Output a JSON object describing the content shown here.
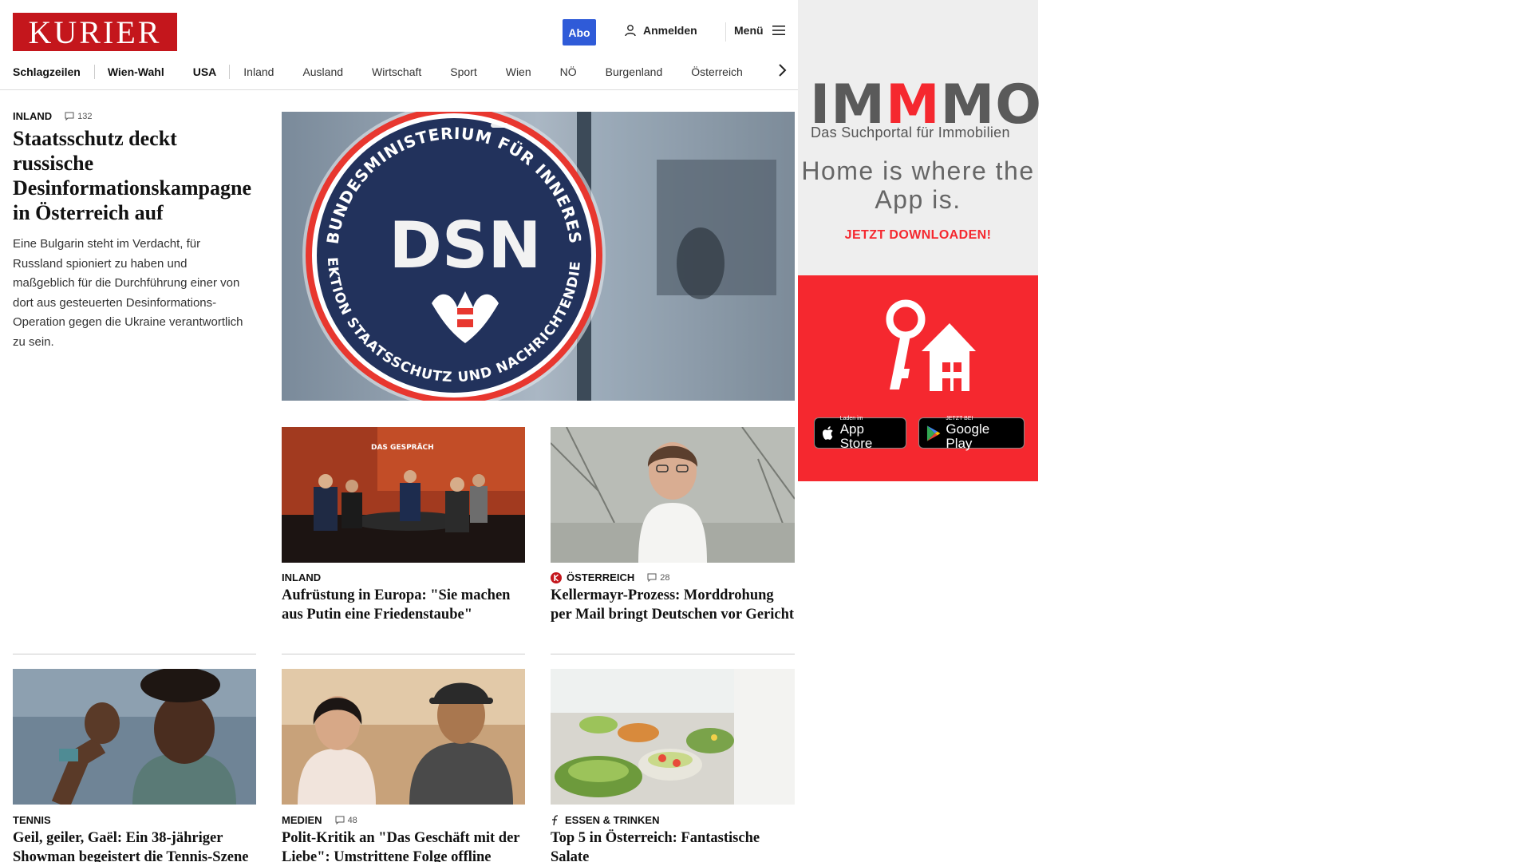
{
  "header": {
    "logo": "KURIER",
    "abo_label": "Abo",
    "login_label": "Anmelden",
    "menu_label": "Menü"
  },
  "nav": {
    "items": [
      "Schlagzeilen",
      "Wien-Wahl",
      "USA",
      "Inland",
      "Ausland",
      "Wirtschaft",
      "Sport",
      "Wien",
      "NÖ",
      "Burgenland",
      "Österreich"
    ]
  },
  "lead": {
    "kicker": "INLAND",
    "comments": "132",
    "title": "Staatsschutz deckt russische Desinformationskampagne in Österreich auf",
    "text": "Eine Bulgarin steht im Verdacht, für Russland spioniert zu haben und maßgeblich für die Durchführung einer von dort aus gesteuerten Desinformations-Operation gegen die Ukraine verantwortlich zu sein.",
    "image_seal": {
      "top_text": "BUNDESMINISTERIUM FÜR INNERES",
      "center_text": "DSN",
      "bottom_text": "DIREKTION STAATSSCHUTZ UND NACHRICHTENDIENST"
    }
  },
  "cards": [
    {
      "kicker": "INLAND",
      "comments": "",
      "title": "Aufrüstung in Europa: \"Sie machen aus Putin eine Friedenstaube\"",
      "image_text": "DAS GESPRÄCH"
    },
    {
      "kicker": "ÖSTERREICH",
      "comments": "28",
      "title": "Kellermayr-Prozess: Morddrohung per Mail bringt Deutschen vor Gericht"
    },
    {
      "kicker": "TENNIS",
      "comments": "",
      "title": "Geil, geiler, Gaël: Ein 38-jähriger Showman begeistert die Tennis-Szene"
    },
    {
      "kicker": "MEDIEN",
      "comments": "48",
      "title": "Polit-Kritik an \"Das Geschäft mit der Liebe\": Umstrittene Folge offline genommen"
    },
    {
      "kicker": "ESSEN & TRINKEN",
      "comments": "",
      "title": "Top 5 in Österreich: Fantastische Salate"
    }
  ],
  "ad": {
    "brand_part1": "IM",
    "brand_part2": "M",
    "brand_part3": "MO",
    "tagline": "Das Suchportal für Immobilien",
    "headline": "Home is where the App is.",
    "cta": "JETZT DOWNLOADEN!",
    "appstore_small": "Laden im",
    "appstore_big": "App Store",
    "googleplay_small": "JETZT BEI",
    "googleplay_big": "Google Play"
  },
  "colors": {
    "brand_red": "#c4161c",
    "abo_blue": "#2f5bd8",
    "ad_red": "#f5282f",
    "ad_gray_bg": "#eeeeee"
  }
}
